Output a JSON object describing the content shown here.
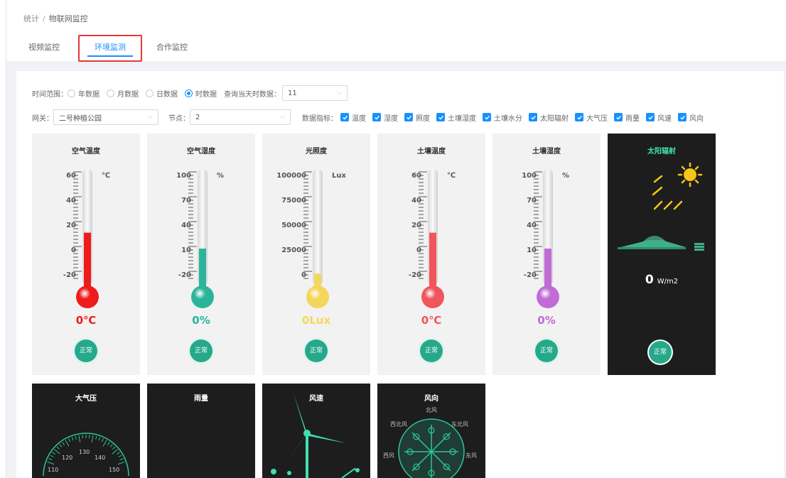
{
  "breadcrumb": {
    "root": "统计",
    "sep": "/",
    "current": "物联网监控"
  },
  "tabs": [
    {
      "label": "视频监控",
      "active": false
    },
    {
      "label": "环境监测",
      "active": true
    },
    {
      "label": "合作监控",
      "active": false
    }
  ],
  "filters": {
    "time_range_label": "时间范围：",
    "time_options": [
      {
        "label": "年数据",
        "selected": false
      },
      {
        "label": "月数据",
        "selected": false
      },
      {
        "label": "日数据",
        "selected": false
      },
      {
        "label": "时数据",
        "selected": true
      }
    ],
    "query_label": "查询当天时数据：",
    "query_value": "11",
    "gateway_label": "网关：",
    "gateway_value": "二号种植公园",
    "node_label": "节点：",
    "node_value": "2",
    "metrics_label": "数据指标：",
    "metrics": [
      "温度",
      "湿度",
      "照度",
      "土壤湿度",
      "土壤水分",
      "太阳辐射",
      "大气压",
      "雨量",
      "风速",
      "风向"
    ]
  },
  "cards": [
    {
      "title": "空气温度",
      "unit": "℃",
      "ticks": [
        "60",
        "40",
        "20",
        "0",
        "-20"
      ],
      "reading": "0℃",
      "color": "#ee1c1c",
      "fill_fraction": 0.44,
      "status": "正常"
    },
    {
      "title": "空气湿度",
      "unit": "%",
      "ticks": [
        "100",
        "70",
        "40",
        "10",
        "-20"
      ],
      "reading": "0%",
      "color": "#2ab59a",
      "fill_fraction": 0.3,
      "status": "正常"
    },
    {
      "title": "光照度",
      "unit": "Lux",
      "ticks": [
        "100000",
        "75000",
        "50000",
        "25000",
        "0"
      ],
      "reading": "0Lux",
      "color": "#f5d65c",
      "fill_fraction": 0.08,
      "status": "正常"
    },
    {
      "title": "土壤温度",
      "unit": "℃",
      "ticks": [
        "60",
        "40",
        "20",
        "0",
        "-20"
      ],
      "reading": "0℃",
      "color": "#f0555b",
      "fill_fraction": 0.44,
      "status": "正常"
    },
    {
      "title": "土壤湿度",
      "unit": "%",
      "ticks": [
        "100",
        "70",
        "40",
        "10",
        "-20"
      ],
      "reading": "0%",
      "color": "#c06bd6",
      "fill_fraction": 0.3,
      "status": "正常"
    }
  ],
  "solar": {
    "title": "太阳辐射",
    "value": "0",
    "unit": "W/m2",
    "status": "正常"
  },
  "bottom_cards": [
    {
      "title": "大气压",
      "gauge_labels": [
        "110",
        "120",
        "130",
        "140",
        "150"
      ]
    },
    {
      "title": "雨量"
    },
    {
      "title": "风速"
    },
    {
      "title": "风向",
      "directions": [
        "北风",
        "西北风",
        "东北风",
        "西风",
        "东风"
      ]
    }
  ],
  "colors": {
    "accent": "#1890ff",
    "green": "#26a98b",
    "teal": "#3fe0b0",
    "highlight": "#e53935"
  }
}
